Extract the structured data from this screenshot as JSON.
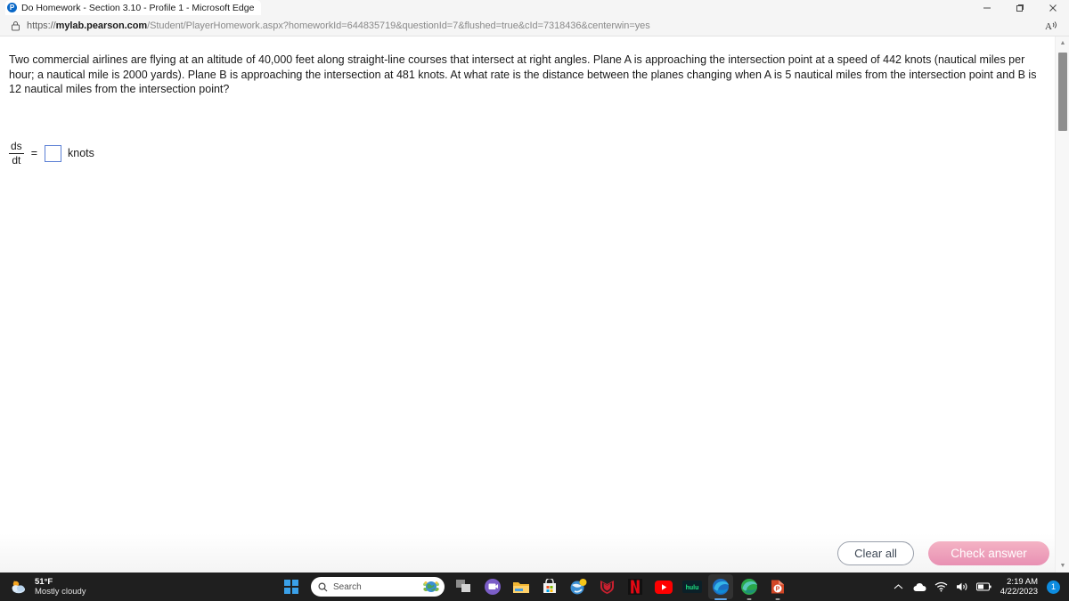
{
  "browser": {
    "tab": {
      "title": "Do Homework - Section 3.10 - Profile 1 - Microsoft Edge",
      "favicon_letter": "P",
      "favicon_name": "pearson-logo-icon"
    },
    "window_controls": {
      "minimize": "minimize-icon",
      "restore": "restore-icon",
      "close": "close-icon"
    },
    "address": {
      "scheme": "https://",
      "host": "mylab.pearson.com",
      "path": "/Student/PlayerHomework.aspx?homeworkId=644835719&questionId=7&flushed=true&cId=7318436&centerwin=yes",
      "lock_icon": "padlock-icon"
    },
    "read_aloud_label": "A"
  },
  "question": {
    "text": "Two commercial airlines are flying at an altitude of 40,000 feet along straight-line courses that intersect at right angles. Plane A is approaching the intersection point at a speed of 442 knots (nautical miles per hour; a nautical mile is 2000 yards). Plane B is approaching the intersection at 481 knots. At what rate is the distance between the planes changing when A is 5 nautical miles from the intersection point and B is 12 nautical miles from the intersection point?"
  },
  "answer": {
    "numerator": "ds",
    "denominator": "dt",
    "equals": "=",
    "input_value": "",
    "input_placeholder": "",
    "unit": "knots",
    "input_border_color": "#5b7fd4"
  },
  "actions": {
    "clear_all_label": "Clear all",
    "check_answer_label": "Check answer",
    "check_answer_color": "#e890b3"
  },
  "scrollbar": {
    "up_arrow": "▲",
    "down_arrow": "▼"
  },
  "taskbar": {
    "weather": {
      "temperature": "51°F",
      "condition": "Mostly cloudy",
      "icon": "sun-behind-cloud-icon"
    },
    "start_label": "start-icon",
    "search": {
      "placeholder": "Search",
      "search_icon": "magnifier-icon",
      "badge_icon": "earth-day-globe-icon"
    },
    "apps": [
      {
        "name": "task-view-icon",
        "label": "Task view"
      },
      {
        "name": "teams-chat-icon",
        "label": "Chat"
      },
      {
        "name": "file-explorer-icon",
        "label": "File Explorer"
      },
      {
        "name": "microsoft-store-icon",
        "label": "Microsoft Store"
      },
      {
        "name": "get-help-icon",
        "label": "Get Help"
      },
      {
        "name": "mcafee-icon",
        "label": "McAfee"
      },
      {
        "name": "netflix-icon",
        "label": "Netflix"
      },
      {
        "name": "youtube-icon",
        "label": "YouTube"
      },
      {
        "name": "hulu-icon",
        "label": "hulu"
      },
      {
        "name": "microsoft-edge-icon",
        "label": "Microsoft Edge"
      },
      {
        "name": "microsoft-edge-dev-icon",
        "label": "Microsoft Edge Dev"
      },
      {
        "name": "powerpoint-icon",
        "label": "PowerPoint"
      }
    ],
    "tray": {
      "overflow": "chevron-up-icon",
      "onedrive": "cloud-icon",
      "wifi": "wifi-icon",
      "volume": "speaker-icon",
      "battery": "battery-icon",
      "time": "2:19 AM",
      "date": "4/22/2023",
      "notification_count": "1"
    }
  }
}
